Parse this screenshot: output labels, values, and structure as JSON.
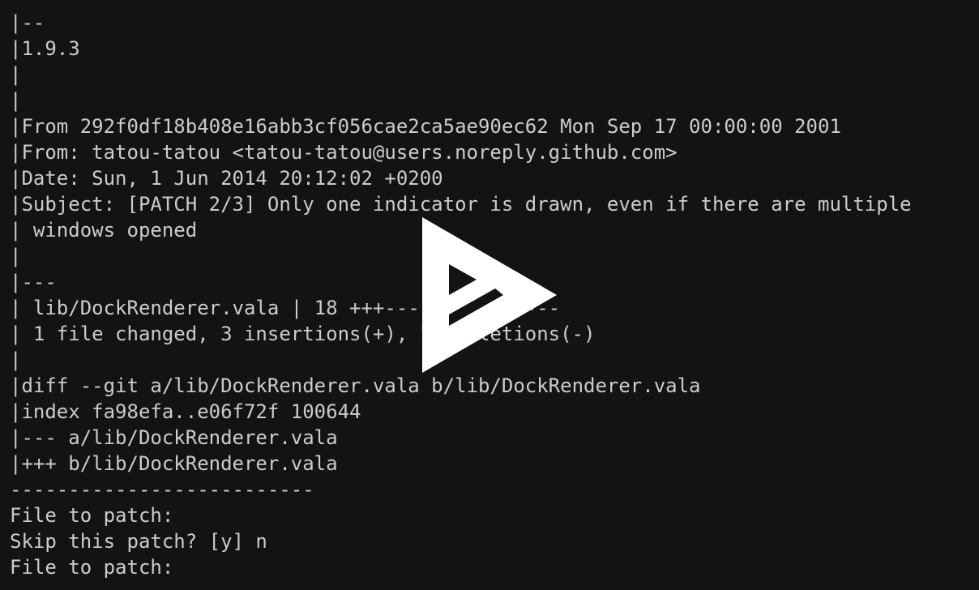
{
  "terminal": {
    "lines": [
      "|--",
      "|1.9.3",
      "|",
      "|",
      "|From 292f0df18b408e16abb3cf056cae2ca5ae90ec62 Mon Sep 17 00:00:00 2001",
      "|From: tatou-tatou <tatou-tatou@users.noreply.github.com>",
      "|Date: Sun, 1 Jun 2014 20:12:02 +0200",
      "|Subject: [PATCH 2/3] Only one indicator is drawn, even if there are multiple",
      "| windows opened",
      "|",
      "|---",
      "| lib/DockRenderer.vala | 18 +++---------------",
      "| 1 file changed, 3 insertions(+), 15 deletions(-)",
      "|",
      "|diff --git a/lib/DockRenderer.vala b/lib/DockRenderer.vala",
      "|index fa98efa..e06f72f 100644",
      "|--- a/lib/DockRenderer.vala",
      "|+++ b/lib/DockRenderer.vala",
      "--------------------------",
      "File to patch:",
      "Skip this patch? [y] n",
      "File to patch:"
    ]
  },
  "overlay": {
    "icon": "play-icon",
    "color": "#ffffff",
    "background": "#121314",
    "text_color": "#cccccc"
  }
}
